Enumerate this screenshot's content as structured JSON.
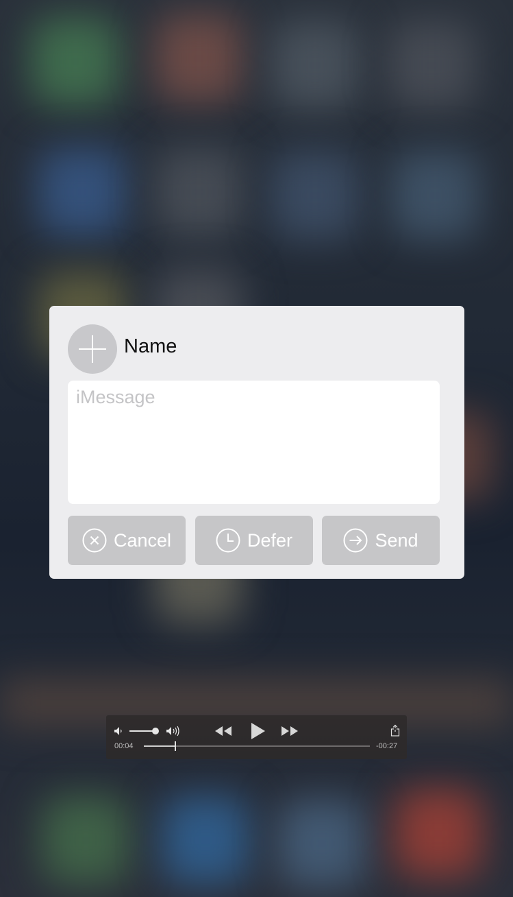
{
  "compose": {
    "name": "Name",
    "message_placeholder": "iMessage",
    "buttons": {
      "cancel": "Cancel",
      "defer": "Defer",
      "send": "Send"
    }
  },
  "player": {
    "elapsed": "00:04",
    "remaining": "-00:27",
    "progress_fraction": 0.14,
    "volume_fraction": 0.9
  },
  "colors": {
    "card_background": "#ededef",
    "button_background": "#c6c6c8",
    "placeholder": "#c4c4c6",
    "player_background": "#2d2a2a"
  },
  "icons": {
    "avatar": "plus-icon",
    "cancel": "x-circle-icon",
    "defer": "clock-icon",
    "send": "arrow-right-circle-icon",
    "volume_low": "speaker-low-icon",
    "volume_high": "speaker-high-icon",
    "rewind": "rewind-icon",
    "play": "play-icon",
    "forward": "fast-forward-icon",
    "share": "share-icon"
  }
}
